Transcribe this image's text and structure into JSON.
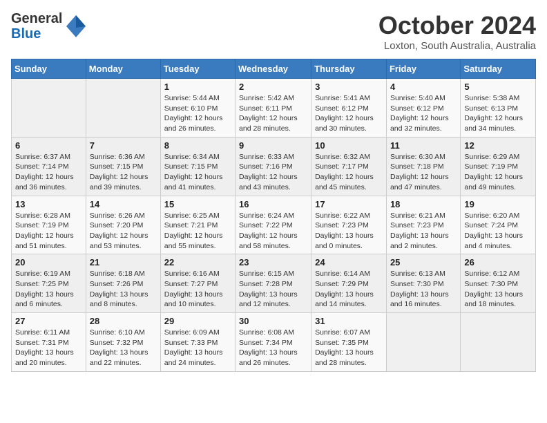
{
  "header": {
    "logo_line1": "General",
    "logo_line2": "Blue",
    "month": "October 2024",
    "location": "Loxton, South Australia, Australia"
  },
  "weekdays": [
    "Sunday",
    "Monday",
    "Tuesday",
    "Wednesday",
    "Thursday",
    "Friday",
    "Saturday"
  ],
  "weeks": [
    [
      {
        "day": "",
        "info": ""
      },
      {
        "day": "",
        "info": ""
      },
      {
        "day": "1",
        "info": "Sunrise: 5:44 AM\nSunset: 6:10 PM\nDaylight: 12 hours and 26 minutes."
      },
      {
        "day": "2",
        "info": "Sunrise: 5:42 AM\nSunset: 6:11 PM\nDaylight: 12 hours and 28 minutes."
      },
      {
        "day": "3",
        "info": "Sunrise: 5:41 AM\nSunset: 6:12 PM\nDaylight: 12 hours and 30 minutes."
      },
      {
        "day": "4",
        "info": "Sunrise: 5:40 AM\nSunset: 6:12 PM\nDaylight: 12 hours and 32 minutes."
      },
      {
        "day": "5",
        "info": "Sunrise: 5:38 AM\nSunset: 6:13 PM\nDaylight: 12 hours and 34 minutes."
      }
    ],
    [
      {
        "day": "6",
        "info": "Sunrise: 6:37 AM\nSunset: 7:14 PM\nDaylight: 12 hours and 36 minutes."
      },
      {
        "day": "7",
        "info": "Sunrise: 6:36 AM\nSunset: 7:15 PM\nDaylight: 12 hours and 39 minutes."
      },
      {
        "day": "8",
        "info": "Sunrise: 6:34 AM\nSunset: 7:15 PM\nDaylight: 12 hours and 41 minutes."
      },
      {
        "day": "9",
        "info": "Sunrise: 6:33 AM\nSunset: 7:16 PM\nDaylight: 12 hours and 43 minutes."
      },
      {
        "day": "10",
        "info": "Sunrise: 6:32 AM\nSunset: 7:17 PM\nDaylight: 12 hours and 45 minutes."
      },
      {
        "day": "11",
        "info": "Sunrise: 6:30 AM\nSunset: 7:18 PM\nDaylight: 12 hours and 47 minutes."
      },
      {
        "day": "12",
        "info": "Sunrise: 6:29 AM\nSunset: 7:19 PM\nDaylight: 12 hours and 49 minutes."
      }
    ],
    [
      {
        "day": "13",
        "info": "Sunrise: 6:28 AM\nSunset: 7:19 PM\nDaylight: 12 hours and 51 minutes."
      },
      {
        "day": "14",
        "info": "Sunrise: 6:26 AM\nSunset: 7:20 PM\nDaylight: 12 hours and 53 minutes."
      },
      {
        "day": "15",
        "info": "Sunrise: 6:25 AM\nSunset: 7:21 PM\nDaylight: 12 hours and 55 minutes."
      },
      {
        "day": "16",
        "info": "Sunrise: 6:24 AM\nSunset: 7:22 PM\nDaylight: 12 hours and 58 minutes."
      },
      {
        "day": "17",
        "info": "Sunrise: 6:22 AM\nSunset: 7:23 PM\nDaylight: 13 hours and 0 minutes."
      },
      {
        "day": "18",
        "info": "Sunrise: 6:21 AM\nSunset: 7:23 PM\nDaylight: 13 hours and 2 minutes."
      },
      {
        "day": "19",
        "info": "Sunrise: 6:20 AM\nSunset: 7:24 PM\nDaylight: 13 hours and 4 minutes."
      }
    ],
    [
      {
        "day": "20",
        "info": "Sunrise: 6:19 AM\nSunset: 7:25 PM\nDaylight: 13 hours and 6 minutes."
      },
      {
        "day": "21",
        "info": "Sunrise: 6:18 AM\nSunset: 7:26 PM\nDaylight: 13 hours and 8 minutes."
      },
      {
        "day": "22",
        "info": "Sunrise: 6:16 AM\nSunset: 7:27 PM\nDaylight: 13 hours and 10 minutes."
      },
      {
        "day": "23",
        "info": "Sunrise: 6:15 AM\nSunset: 7:28 PM\nDaylight: 13 hours and 12 minutes."
      },
      {
        "day": "24",
        "info": "Sunrise: 6:14 AM\nSunset: 7:29 PM\nDaylight: 13 hours and 14 minutes."
      },
      {
        "day": "25",
        "info": "Sunrise: 6:13 AM\nSunset: 7:30 PM\nDaylight: 13 hours and 16 minutes."
      },
      {
        "day": "26",
        "info": "Sunrise: 6:12 AM\nSunset: 7:30 PM\nDaylight: 13 hours and 18 minutes."
      }
    ],
    [
      {
        "day": "27",
        "info": "Sunrise: 6:11 AM\nSunset: 7:31 PM\nDaylight: 13 hours and 20 minutes."
      },
      {
        "day": "28",
        "info": "Sunrise: 6:10 AM\nSunset: 7:32 PM\nDaylight: 13 hours and 22 minutes."
      },
      {
        "day": "29",
        "info": "Sunrise: 6:09 AM\nSunset: 7:33 PM\nDaylight: 13 hours and 24 minutes."
      },
      {
        "day": "30",
        "info": "Sunrise: 6:08 AM\nSunset: 7:34 PM\nDaylight: 13 hours and 26 minutes."
      },
      {
        "day": "31",
        "info": "Sunrise: 6:07 AM\nSunset: 7:35 PM\nDaylight: 13 hours and 28 minutes."
      },
      {
        "day": "",
        "info": ""
      },
      {
        "day": "",
        "info": ""
      }
    ]
  ]
}
